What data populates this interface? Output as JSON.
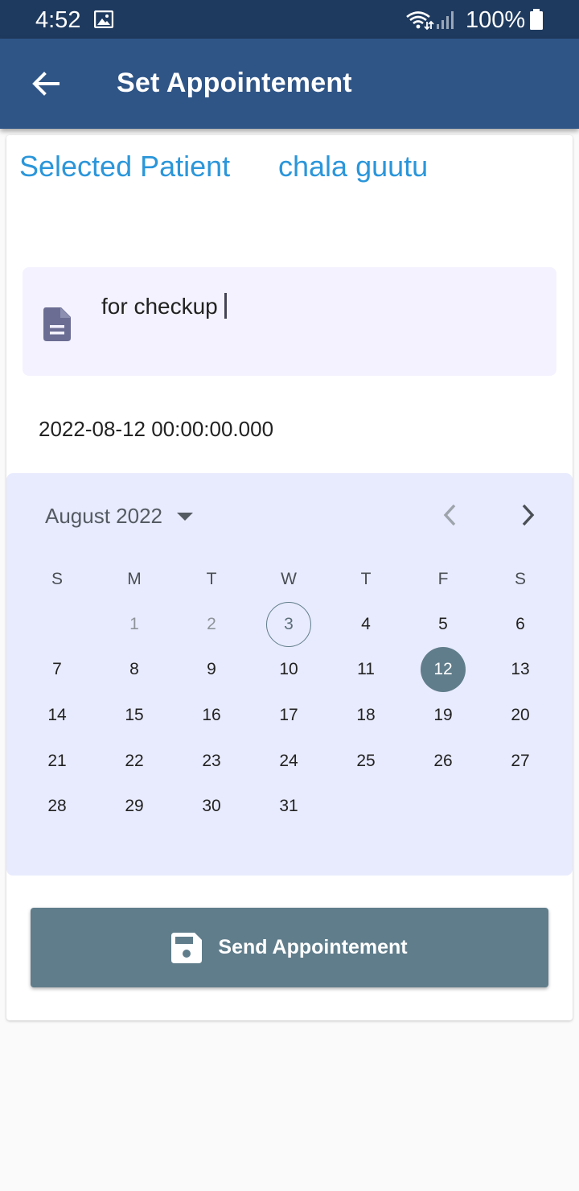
{
  "status_bar": {
    "time": "4:52",
    "battery": "100%",
    "icons": [
      "gallery-icon",
      "wifi-icon",
      "signal-icon",
      "battery-icon"
    ]
  },
  "app_bar": {
    "title": "Set Appointement",
    "back_icon": "arrow-back-icon",
    "color": "#2f5587"
  },
  "patient": {
    "label": "Selected Patient",
    "name": "chala guutu",
    "color": "#2b96da"
  },
  "note": {
    "value": "for checkup",
    "icon": "document-icon"
  },
  "selected_datetime": "2022-08-12 00:00:00.000",
  "calendar": {
    "month_label": "August 2022",
    "weekdays": [
      "S",
      "M",
      "T",
      "W",
      "T",
      "F",
      "S"
    ],
    "first_weekday_index": 1,
    "days_in_month": 31,
    "today": 3,
    "selected": 12,
    "disabled_days": [
      1,
      2
    ],
    "background": "#e8ebfd",
    "accent": "#607d8b"
  },
  "send_button": {
    "label": "Send Appointement",
    "icon": "save-icon",
    "color": "#607d8b"
  }
}
